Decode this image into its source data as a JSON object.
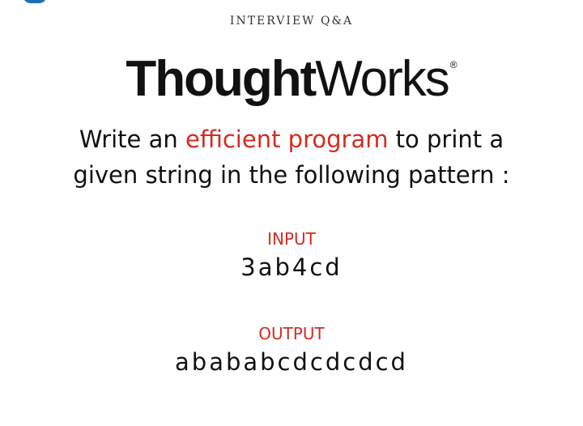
{
  "kicker": "INTERVIEW Q&A",
  "brand": {
    "bold": "Thought",
    "light": "Works",
    "registered": "®"
  },
  "question": {
    "line1_before": "Write an ",
    "line1_highlight": "efficient program",
    "line1_after": " to print a",
    "line2": "given string in the following pattern :"
  },
  "input": {
    "label": "INPUT",
    "value": "3ab4cd"
  },
  "output": {
    "label": "OUTPUT",
    "value": "abababcdcdcdcd"
  },
  "colors": {
    "accent": "#d52b22",
    "text": "#111111",
    "background": "#ffffff"
  }
}
